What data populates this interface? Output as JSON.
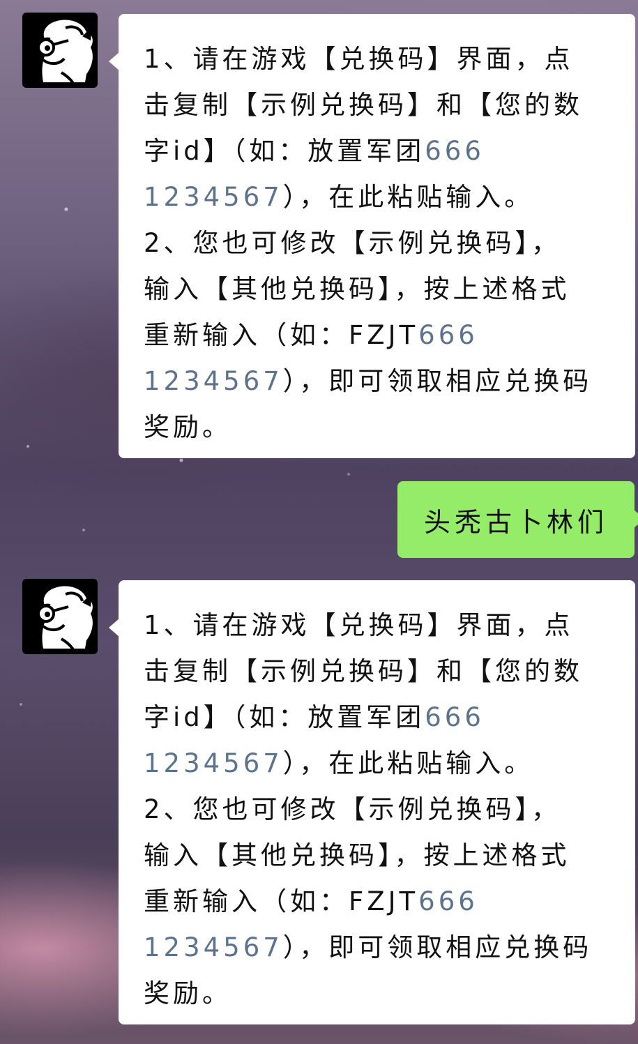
{
  "chat": {
    "messages": [
      {
        "sender": "bot",
        "avatar_icon": "cartoon-face-avatar-icon",
        "lines": [
          {
            "text": "1、请在游戏【兑换码】界面，点"
          },
          {
            "text": "击复制【示例兑换码】和【您的数"
          },
          {
            "text": "字id】（如：放置军团",
            "number": "666"
          },
          {
            "number": "1234567",
            "text": "），在此粘贴输入。"
          },
          {
            "text": "2、您也可修改【示例兑换码】，"
          },
          {
            "text": "输入【其他兑换码】，按上述格式"
          },
          {
            "text": "重新输入（如：FZJT",
            "number": "666"
          },
          {
            "number": "1234567",
            "text": "），即可领取相应兑换码"
          },
          {
            "text": "奖励。"
          }
        ]
      },
      {
        "sender": "me",
        "text": "头秃古卜林们"
      },
      {
        "sender": "bot",
        "avatar_icon": "cartoon-face-avatar-icon",
        "lines": [
          {
            "text": "1、请在游戏【兑换码】界面，点"
          },
          {
            "text": "击复制【示例兑换码】和【您的数"
          },
          {
            "text": "字id】（如：放置军团",
            "number": "666"
          },
          {
            "number": "1234567",
            "text": "），在此粘贴输入。"
          },
          {
            "text": "2、您也可修改【示例兑换码】，"
          },
          {
            "text": "输入【其他兑换码】，按上述格式"
          },
          {
            "text": "重新输入（如：FZJT",
            "number": "666"
          },
          {
            "number": "1234567",
            "text": "），即可领取相应兑换码"
          },
          {
            "text": "奖励。"
          }
        ]
      }
    ]
  },
  "colors": {
    "sent_bubble": "#95ec69",
    "received_bubble": "#ffffff",
    "number_text": "#5d728c",
    "text": "#111111"
  }
}
